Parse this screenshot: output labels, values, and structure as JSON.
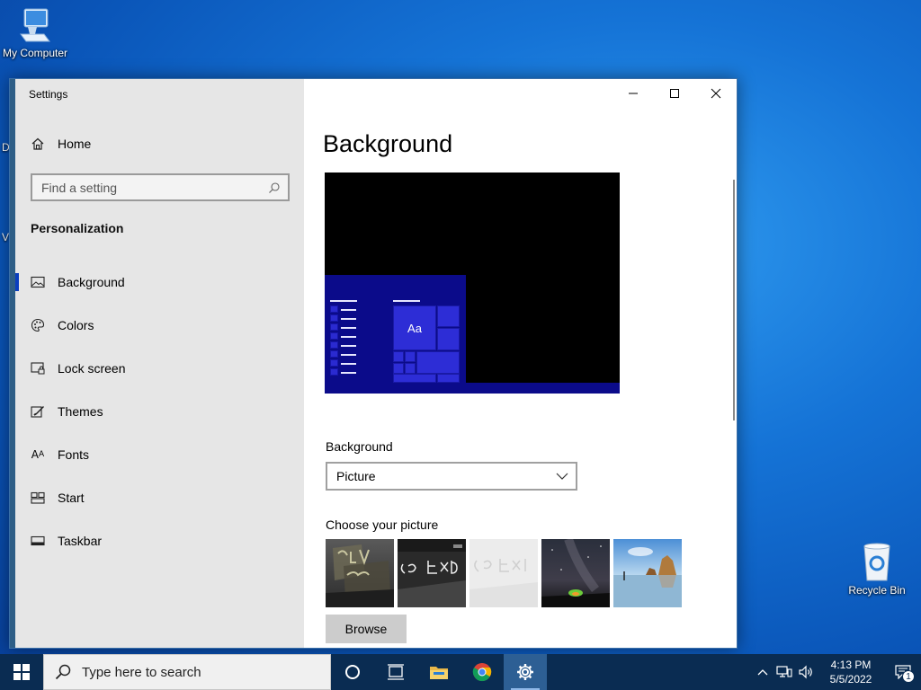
{
  "desktop": {
    "my_computer": "My Computer",
    "recycle_bin": "Recycle Bin",
    "edge_fragments": [
      "D",
      "V"
    ]
  },
  "settings": {
    "app_title": "Settings",
    "home": "Home",
    "search_placeholder": "Find a setting",
    "section": "Personalization",
    "nav": [
      {
        "label": "Background",
        "icon": "picture-icon",
        "active": true
      },
      {
        "label": "Colors",
        "icon": "palette-icon"
      },
      {
        "label": "Lock screen",
        "icon": "lock-screen-icon"
      },
      {
        "label": "Themes",
        "icon": "themes-icon"
      },
      {
        "label": "Fonts",
        "icon": "fonts-icon"
      },
      {
        "label": "Start",
        "icon": "start-icon"
      },
      {
        "label": "Taskbar",
        "icon": "taskbar-icon"
      }
    ],
    "page_title": "Background",
    "preview_sample": "Aa",
    "background_label": "Background",
    "background_value": "Picture",
    "choose_label": "Choose your picture",
    "browse": "Browse",
    "accent_color": "#0b3fbf"
  },
  "taskbar": {
    "search_placeholder": "Type here to search",
    "time": "4:13 PM",
    "date": "5/5/2022",
    "notifications": "1"
  }
}
